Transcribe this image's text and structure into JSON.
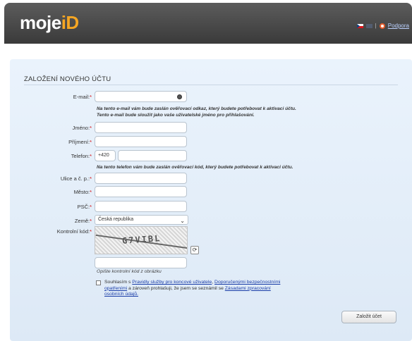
{
  "header": {
    "logo_main": "moje",
    "logo_id": "iD",
    "support_label": "Podpora"
  },
  "form": {
    "title": "ZALOŽENÍ NOVÉHO ÚČTU",
    "email_label": "E-mail:",
    "email_note_1": "Na tento e-mail vám bude zaslán ověřovací odkaz, který budete potřebovat k aktivaci účtu.",
    "email_note_2": "Tento e-mail bude sloužit jako vaše uživatelské jméno pro přihlašování.",
    "first_name_label": "Jméno:",
    "last_name_label": "Příjmení:",
    "phone_label": "Telefon:",
    "phone_prefix": "+420",
    "phone_note": "Na tento telefon vám bude zaslán ověřovací kód, který budete potřebovat k aktivaci účtu.",
    "street_label": "Ulice a č. p.:",
    "city_label": "Město:",
    "zip_label": "PSČ:",
    "country_label": "Země:",
    "country_value": "Česká republika",
    "captcha_label": "Kontrolní kód:",
    "captcha_text": "G7VIBL",
    "captcha_hint": "Opište kontrolní kód z obrázku",
    "consent_prefix": "Souhlasím s",
    "consent_link_1": "Pravidly služby pro koncové uživatele",
    "consent_link_2": "Doporučenými bezpečnostními opatřeními",
    "consent_mid": "a zároveň prohlašuji, že jsem se seznámil se",
    "consent_link_3": "Zásadami zpracování osobních údajů.",
    "submit_label": "Založit účet",
    "required_mark": "*"
  }
}
